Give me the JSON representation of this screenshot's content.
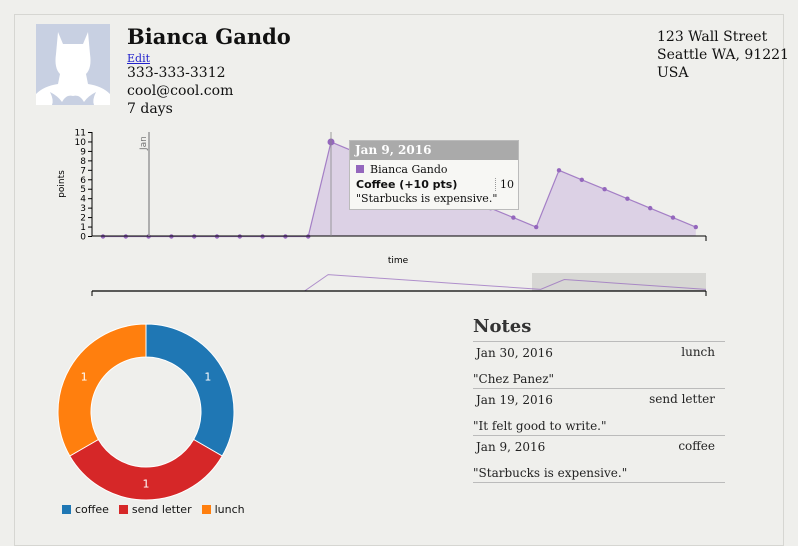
{
  "profile": {
    "name": "Bianca Gando",
    "edit_label": "Edit",
    "phone": "333-333-3312",
    "email": "cool@cool.com",
    "duration": "7 days",
    "address_line1": "123 Wall Street",
    "address_line2": "Seattle WA, 91221",
    "address_line3": "USA",
    "avatar_icon": "batman-silhouette-icon"
  },
  "timeline": {
    "ylabel": "points",
    "xlabel": "time",
    "month_marker": "Jan",
    "area_color": "#d9cde4",
    "line_color": "#9467bd",
    "tooltip": {
      "title": "Jan 9, 2016",
      "person": "Bianca Gando",
      "event": "Coffee (+10 pts)",
      "quote": "\"Starbucks is expensive.\"",
      "value": "10"
    }
  },
  "chart_data": {
    "type": "area",
    "title": "",
    "xlabel": "time",
    "ylabel": "points",
    "ylim": [
      0,
      11
    ],
    "y_ticks": [
      0,
      1,
      2,
      3,
      4,
      5,
      6,
      7,
      8,
      9,
      10,
      11
    ],
    "values": [
      0,
      0,
      0,
      0,
      0,
      0,
      0,
      0,
      0,
      0,
      10,
      9,
      8,
      7,
      6,
      5,
      4,
      3,
      2,
      1,
      7,
      6,
      5,
      4,
      3,
      2,
      1
    ]
  },
  "pie": {
    "type": "pie",
    "segments": [
      {
        "name": "coffee",
        "value": 1,
        "label": "1",
        "color": "#1f77b4"
      },
      {
        "name": "send letter",
        "value": 1,
        "label": "1",
        "color": "#d62728"
      },
      {
        "name": "lunch",
        "value": 1,
        "label": "1",
        "color": "#ff7f0e"
      }
    ]
  },
  "notes": {
    "title": "Notes",
    "items": [
      {
        "date": "Jan 30, 2016",
        "category": "lunch",
        "text": "\"Chez Panez\""
      },
      {
        "date": "Jan 19, 2016",
        "category": "send letter",
        "text": "\"It felt good to write.\""
      },
      {
        "date": "Jan 9, 2016",
        "category": "coffee",
        "text": "\"Starbucks is expensive.\""
      }
    ]
  }
}
